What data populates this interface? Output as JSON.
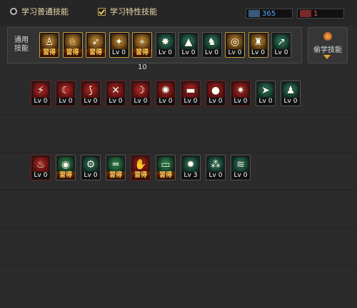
{
  "tabs": {
    "normal_label": "学习普通技能",
    "trait_label": "学习特性技能"
  },
  "counters": {
    "blue_value": "365",
    "red_value": "1"
  },
  "panel": {
    "label_line1": "通用",
    "label_line2": "技能",
    "count_label": "10"
  },
  "steal": {
    "label": "偷学技能"
  },
  "colors": {
    "blue_counter": "#4ea6ff",
    "red_counter": "#e85050",
    "learned_text": "#ffd060"
  },
  "general_skills": [
    {
      "icon": "sitting-figure-icon",
      "status": "習得",
      "style": "gold"
    },
    {
      "icon": "running-figure-icon",
      "status": "習得",
      "style": "gold"
    },
    {
      "icon": "dash-figure-icon",
      "status": "習得",
      "style": "gold"
    },
    {
      "icon": "wings-icon",
      "status": "Lv 0",
      "style": "gold"
    },
    {
      "icon": "crosshair-icon",
      "status": "習得",
      "style": "gold"
    },
    {
      "icon": "target-burst-icon",
      "status": "Lv 0",
      "style": "green"
    },
    {
      "icon": "mountain-figure-icon",
      "status": "Lv 0",
      "style": "green"
    },
    {
      "icon": "kick-figure-icon",
      "status": "Lv 0",
      "style": "green"
    },
    {
      "icon": "shield-ring-icon",
      "status": "Lv 0",
      "style": "gold"
    },
    {
      "icon": "strong-figure-icon",
      "status": "Lv 0",
      "style": "gold"
    },
    {
      "icon": "jump-figure-icon",
      "status": "Lv 0",
      "style": "green"
    }
  ],
  "row2_skills": [
    {
      "icon": "lightning-blade-icon",
      "status": "Lv 0",
      "style": "red"
    },
    {
      "icon": "slash-arc-icon",
      "status": "Lv 0",
      "style": "red"
    },
    {
      "icon": "curved-blade-icon",
      "status": "Lv 0",
      "style": "red"
    },
    {
      "icon": "claw-strike-icon",
      "status": "Lv 0",
      "style": "red"
    },
    {
      "icon": "sickle-icon",
      "status": "Lv 0",
      "style": "red"
    },
    {
      "icon": "explosion-icon",
      "status": "Lv 0",
      "style": "red"
    },
    {
      "icon": "cannon-icon",
      "status": "Lv 0",
      "style": "red"
    },
    {
      "icon": "grenade-icon",
      "status": "Lv 0",
      "style": "red"
    },
    {
      "icon": "spark-blast-icon",
      "status": "Lv 0",
      "style": "red"
    },
    {
      "icon": "dash-strike-icon",
      "status": "Lv 0",
      "style": "green"
    },
    {
      "icon": "runner-icon",
      "status": "Lv 0",
      "style": "green"
    }
  ],
  "row3_skills": [
    {
      "icon": "flame-burst-icon",
      "status": "Lv 0",
      "style": "red"
    },
    {
      "icon": "eye-icon",
      "status": "習得",
      "style": "greengold"
    },
    {
      "icon": "gear-gun-icon",
      "status": "Lv 0",
      "style": "green"
    },
    {
      "icon": "rifle-icon",
      "status": "習得",
      "style": "greengold"
    },
    {
      "icon": "grab-icon",
      "status": "習得",
      "style": "red"
    },
    {
      "icon": "laser-beam-icon",
      "status": "習得",
      "style": "greengold"
    },
    {
      "icon": "spiked-mine-icon",
      "status": "Lv 3",
      "style": "green"
    },
    {
      "icon": "scatter-shot-icon",
      "status": "Lv 0",
      "style": "green"
    },
    {
      "icon": "wave-icon",
      "status": "Lv 0",
      "style": "green"
    }
  ]
}
